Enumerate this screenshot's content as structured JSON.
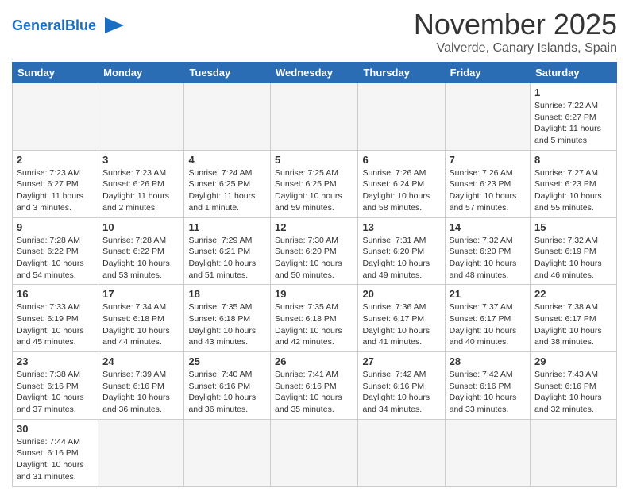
{
  "header": {
    "logo_general": "General",
    "logo_blue": "Blue",
    "title": "November 2025",
    "subtitle": "Valverde, Canary Islands, Spain"
  },
  "weekdays": [
    "Sunday",
    "Monday",
    "Tuesday",
    "Wednesday",
    "Thursday",
    "Friday",
    "Saturday"
  ],
  "weeks": [
    [
      {
        "day": "",
        "info": ""
      },
      {
        "day": "",
        "info": ""
      },
      {
        "day": "",
        "info": ""
      },
      {
        "day": "",
        "info": ""
      },
      {
        "day": "",
        "info": ""
      },
      {
        "day": "",
        "info": ""
      },
      {
        "day": "1",
        "info": "Sunrise: 7:22 AM\nSunset: 6:27 PM\nDaylight: 11 hours\nand 5 minutes."
      }
    ],
    [
      {
        "day": "2",
        "info": "Sunrise: 7:23 AM\nSunset: 6:27 PM\nDaylight: 11 hours\nand 3 minutes."
      },
      {
        "day": "3",
        "info": "Sunrise: 7:23 AM\nSunset: 6:26 PM\nDaylight: 11 hours\nand 2 minutes."
      },
      {
        "day": "4",
        "info": "Sunrise: 7:24 AM\nSunset: 6:25 PM\nDaylight: 11 hours\nand 1 minute."
      },
      {
        "day": "5",
        "info": "Sunrise: 7:25 AM\nSunset: 6:25 PM\nDaylight: 10 hours\nand 59 minutes."
      },
      {
        "day": "6",
        "info": "Sunrise: 7:26 AM\nSunset: 6:24 PM\nDaylight: 10 hours\nand 58 minutes."
      },
      {
        "day": "7",
        "info": "Sunrise: 7:26 AM\nSunset: 6:23 PM\nDaylight: 10 hours\nand 57 minutes."
      },
      {
        "day": "8",
        "info": "Sunrise: 7:27 AM\nSunset: 6:23 PM\nDaylight: 10 hours\nand 55 minutes."
      }
    ],
    [
      {
        "day": "9",
        "info": "Sunrise: 7:28 AM\nSunset: 6:22 PM\nDaylight: 10 hours\nand 54 minutes."
      },
      {
        "day": "10",
        "info": "Sunrise: 7:28 AM\nSunset: 6:22 PM\nDaylight: 10 hours\nand 53 minutes."
      },
      {
        "day": "11",
        "info": "Sunrise: 7:29 AM\nSunset: 6:21 PM\nDaylight: 10 hours\nand 51 minutes."
      },
      {
        "day": "12",
        "info": "Sunrise: 7:30 AM\nSunset: 6:20 PM\nDaylight: 10 hours\nand 50 minutes."
      },
      {
        "day": "13",
        "info": "Sunrise: 7:31 AM\nSunset: 6:20 PM\nDaylight: 10 hours\nand 49 minutes."
      },
      {
        "day": "14",
        "info": "Sunrise: 7:32 AM\nSunset: 6:20 PM\nDaylight: 10 hours\nand 48 minutes."
      },
      {
        "day": "15",
        "info": "Sunrise: 7:32 AM\nSunset: 6:19 PM\nDaylight: 10 hours\nand 46 minutes."
      }
    ],
    [
      {
        "day": "16",
        "info": "Sunrise: 7:33 AM\nSunset: 6:19 PM\nDaylight: 10 hours\nand 45 minutes."
      },
      {
        "day": "17",
        "info": "Sunrise: 7:34 AM\nSunset: 6:18 PM\nDaylight: 10 hours\nand 44 minutes."
      },
      {
        "day": "18",
        "info": "Sunrise: 7:35 AM\nSunset: 6:18 PM\nDaylight: 10 hours\nand 43 minutes."
      },
      {
        "day": "19",
        "info": "Sunrise: 7:35 AM\nSunset: 6:18 PM\nDaylight: 10 hours\nand 42 minutes."
      },
      {
        "day": "20",
        "info": "Sunrise: 7:36 AM\nSunset: 6:17 PM\nDaylight: 10 hours\nand 41 minutes."
      },
      {
        "day": "21",
        "info": "Sunrise: 7:37 AM\nSunset: 6:17 PM\nDaylight: 10 hours\nand 40 minutes."
      },
      {
        "day": "22",
        "info": "Sunrise: 7:38 AM\nSunset: 6:17 PM\nDaylight: 10 hours\nand 38 minutes."
      }
    ],
    [
      {
        "day": "23",
        "info": "Sunrise: 7:38 AM\nSunset: 6:16 PM\nDaylight: 10 hours\nand 37 minutes."
      },
      {
        "day": "24",
        "info": "Sunrise: 7:39 AM\nSunset: 6:16 PM\nDaylight: 10 hours\nand 36 minutes."
      },
      {
        "day": "25",
        "info": "Sunrise: 7:40 AM\nSunset: 6:16 PM\nDaylight: 10 hours\nand 36 minutes."
      },
      {
        "day": "26",
        "info": "Sunrise: 7:41 AM\nSunset: 6:16 PM\nDaylight: 10 hours\nand 35 minutes."
      },
      {
        "day": "27",
        "info": "Sunrise: 7:42 AM\nSunset: 6:16 PM\nDaylight: 10 hours\nand 34 minutes."
      },
      {
        "day": "28",
        "info": "Sunrise: 7:42 AM\nSunset: 6:16 PM\nDaylight: 10 hours\nand 33 minutes."
      },
      {
        "day": "29",
        "info": "Sunrise: 7:43 AM\nSunset: 6:16 PM\nDaylight: 10 hours\nand 32 minutes."
      }
    ],
    [
      {
        "day": "30",
        "info": "Sunrise: 7:44 AM\nSunset: 6:16 PM\nDaylight: 10 hours\nand 31 minutes."
      },
      {
        "day": "",
        "info": ""
      },
      {
        "day": "",
        "info": ""
      },
      {
        "day": "",
        "info": ""
      },
      {
        "day": "",
        "info": ""
      },
      {
        "day": "",
        "info": ""
      },
      {
        "day": "",
        "info": ""
      }
    ]
  ]
}
